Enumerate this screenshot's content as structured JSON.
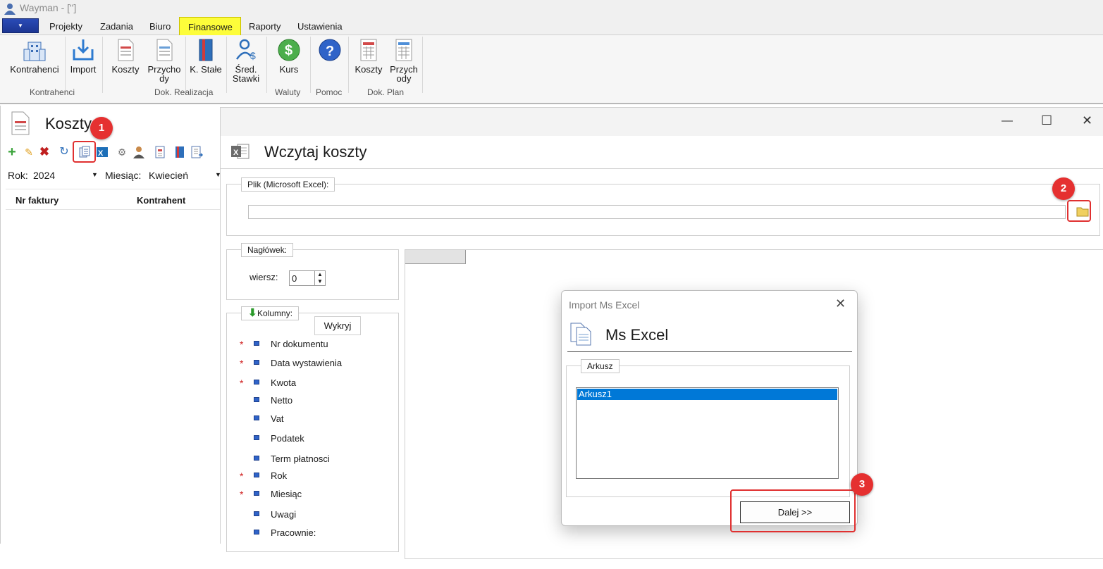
{
  "app": {
    "title": "Wayman - ['']"
  },
  "menu": {
    "items": [
      "Projekty",
      "Zadania",
      "Biuro",
      "Finansowe",
      "Raporty",
      "Ustawienia"
    ],
    "active": "Finansowe",
    "app_button": "▼"
  },
  "ribbon": {
    "buttons": {
      "kontrahenci": "Kontrahenci",
      "import": "Import",
      "koszty": "Koszty",
      "przychody_line1": "Przycho",
      "przychody_line2": "dy",
      "k_stale": "K. Stałe",
      "sred_line1": "Śred.",
      "sred_line2": "Stawki",
      "kurs": "Kurs",
      "koszty2": "Koszty",
      "przychody2_line1": "Przych",
      "przychody2_line2": "ody"
    },
    "groups": {
      "kontrahenci": "Kontrahenci",
      "dok_realizacja": "Dok. Realizacja",
      "waluty": "Waluty",
      "pomoc": "Pomoc",
      "dok_plan": "Dok. Plan"
    }
  },
  "left_panel": {
    "title": "Koszty",
    "rok_label": "Rok:",
    "rok_value": "2024",
    "miesiac_label": "Miesiąc:",
    "miesiac_value": "Kwiecień",
    "columns": [
      "Nr faktury",
      "Kontrahent"
    ]
  },
  "main_window": {
    "title": "Wczytaj koszty",
    "file_legend": "Plik (Microsoft Excel):",
    "file_value": "",
    "naglowek_legend": "Nagłówek:",
    "wiersz_label": "wiersz:",
    "wiersz_value": "0",
    "kolumny_legend": "Kolumny:",
    "wykryj_label": "Wykryj",
    "columns": [
      {
        "label": "Nr dokumentu",
        "required": true
      },
      {
        "label": "Data wystawienia",
        "required": true
      },
      {
        "label": "Kwota",
        "required": true
      },
      {
        "label": "Netto",
        "required": false
      },
      {
        "label": "Vat",
        "required": false
      },
      {
        "label": "Podatek",
        "required": false
      },
      {
        "label": "Term płatnosci",
        "required": false
      },
      {
        "label": "Rok",
        "required": true
      },
      {
        "label": "Miesiąc",
        "required": true
      },
      {
        "label": "Uwagi",
        "required": false
      },
      {
        "label": "Pracownie:",
        "required": false
      }
    ],
    "required_mark": "*"
  },
  "dialog": {
    "window_title": "Import Ms Excel",
    "heading": "Ms Excel",
    "arkusz_legend": "Arkusz",
    "sheets": [
      "Arkusz1"
    ],
    "selected_sheet": "Arkusz1",
    "next_button": "Dalej >>"
  },
  "callouts": [
    "1",
    "2",
    "3"
  ],
  "colors": {
    "accent_highlight": "#fdfd3a",
    "callout": "#e53030",
    "selection": "#0078d7"
  }
}
